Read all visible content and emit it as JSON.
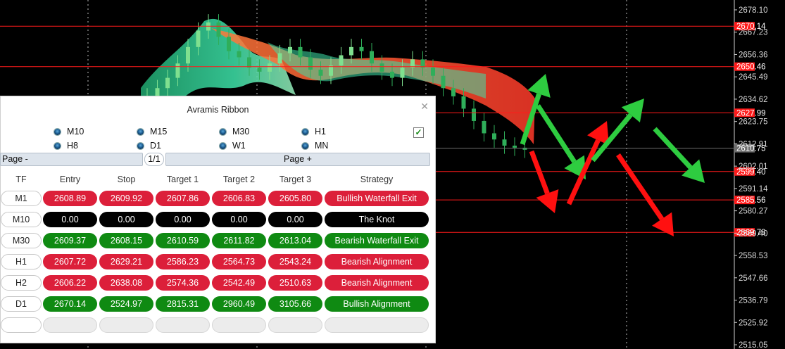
{
  "price_axis": {
    "ticks": [
      "2678.10",
      "2667.23",
      "2656.36",
      "2645.49",
      "2634.62",
      "2623.75",
      "2612.91",
      "2602.01",
      "2591.14",
      "2580.27",
      "2569.40",
      "2558.53",
      "2547.66",
      "2536.79",
      "2525.92",
      "2515.05"
    ],
    "level_labels": [
      "2670.14",
      "2650.46",
      "2627.99",
      "2599.40",
      "2585.56",
      "2569.78"
    ],
    "current_price": "2610.75",
    "colors": {
      "level": "#ff1a1a",
      "current": "#6e6e6e",
      "bull": "#2ecc40",
      "bear": "#ff1010"
    }
  },
  "panel": {
    "title": "Avramis Ribbon",
    "close_icon": "close-icon",
    "timeframes": [
      "M10",
      "M15",
      "M30",
      "H1",
      "H8",
      "D1",
      "W1",
      "MN"
    ],
    "checkbox_checked": true,
    "pager": {
      "prev": "Page -",
      "indicator": "1/1",
      "next": "Page +"
    },
    "columns": [
      "TF",
      "Entry",
      "Stop",
      "Target 1",
      "Target 2",
      "Target 3",
      "Strategy"
    ],
    "rows": [
      {
        "tf": "M1",
        "entry": "2608.89",
        "stop": "2609.92",
        "t1": "2607.86",
        "t2": "2606.83",
        "t3": "2605.80",
        "strategy": "Bullish Waterfall Exit",
        "color": "red"
      },
      {
        "tf": "M10",
        "entry": "0.00",
        "stop": "0.00",
        "t1": "0.00",
        "t2": "0.00",
        "t3": "0.00",
        "strategy": "The Knot",
        "color": "black"
      },
      {
        "tf": "M30",
        "entry": "2609.37",
        "stop": "2608.15",
        "t1": "2610.59",
        "t2": "2611.82",
        "t3": "2613.04",
        "strategy": "Bearish Waterfall Exit",
        "color": "green"
      },
      {
        "tf": "H1",
        "entry": "2607.72",
        "stop": "2629.21",
        "t1": "2586.23",
        "t2": "2564.73",
        "t3": "2543.24",
        "strategy": "Bearish Alignment",
        "color": "red"
      },
      {
        "tf": "H2",
        "entry": "2606.22",
        "stop": "2638.08",
        "t1": "2574.36",
        "t2": "2542.49",
        "t3": "2510.63",
        "strategy": "Bearish Alignment",
        "color": "red"
      },
      {
        "tf": "D1",
        "entry": "2670.14",
        "stop": "2524.97",
        "t1": "2815.31",
        "t2": "2960.49",
        "t3": "3105.66",
        "strategy": "Bullish Alignment",
        "color": "green"
      },
      {
        "tf": "",
        "entry": "",
        "stop": "",
        "t1": "",
        "t2": "",
        "t3": "",
        "strategy": "",
        "color": "empty"
      }
    ]
  }
}
